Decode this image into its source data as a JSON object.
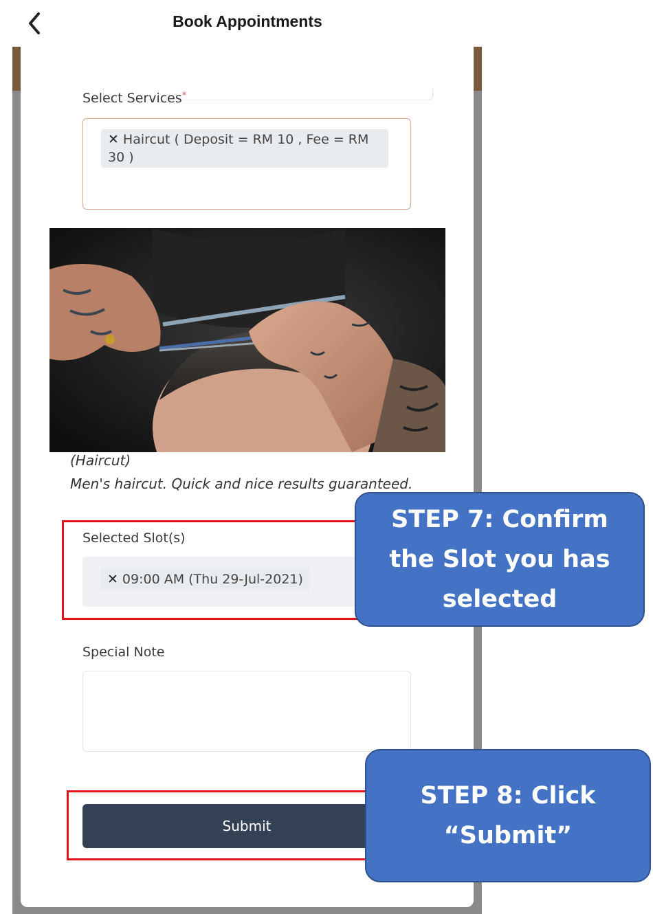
{
  "header": {
    "title": "Book Appointments",
    "back_icon": "chevron-left-icon"
  },
  "services": {
    "label": "Select Services",
    "required_mark": "*",
    "selected": [
      {
        "line1": "Haircut ( Deposit = RM 10 , Fee = RM",
        "line2": "30 )"
      }
    ],
    "remove_icon": "close-icon"
  },
  "service_detail": {
    "name": "(Haircut)",
    "description": "Men's haircut. Quick and nice results guaranteed."
  },
  "slots": {
    "label": "Selected Slot(s)",
    "selected": [
      "09:00 AM (Thu 29-Jul-2021)"
    ]
  },
  "note": {
    "label": "Special Note",
    "value": ""
  },
  "submit": {
    "label": "Submit"
  },
  "callouts": {
    "step7": [
      "STEP 7: Confirm",
      "the Slot you has",
      "selected"
    ],
    "step8": [
      "STEP 8: Click",
      "“Submit”"
    ]
  },
  "colors": {
    "submit_bg": "#344154",
    "highlight": "#e2131a",
    "callout_bg": "#4472c4"
  }
}
